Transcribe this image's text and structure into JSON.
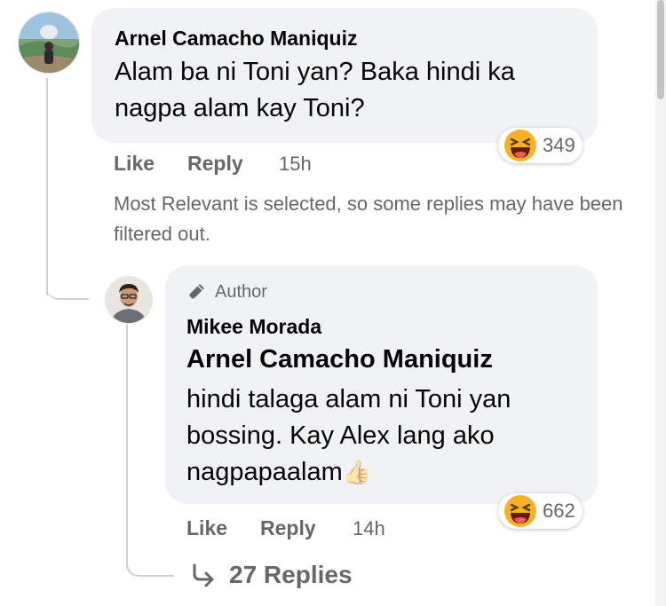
{
  "comment": {
    "author": "Arnel Camacho Maniquiz",
    "text": "Alam ba ni Toni yan? Baka hindi ka nagpa alam kay Toni?",
    "reaction_count": "349",
    "reaction_icon": "haha-emoji",
    "actions": {
      "like": "Like",
      "reply": "Reply"
    },
    "time": "15h"
  },
  "notice": "Most Relevant is selected, so some replies may have been filtered out.",
  "reply": {
    "badge": "Author",
    "author": "Mikee Morada",
    "mention": "Arnel Camacho Maniquiz",
    "text": "hindi talaga alam ni Toni yan bossing. Kay Alex lang ako nagpapaalam",
    "emoji": "👍",
    "reaction_count": "662",
    "reaction_icon": "haha-emoji",
    "actions": {
      "like": "Like",
      "reply": "Reply"
    },
    "time": "14h"
  },
  "replies_link": "27 Replies",
  "colors": {
    "bubble": "#f0f2f5",
    "secondary_text": "#65676b",
    "thread_line": "#ced0d4",
    "emoji_yellow": "#f7b125"
  }
}
